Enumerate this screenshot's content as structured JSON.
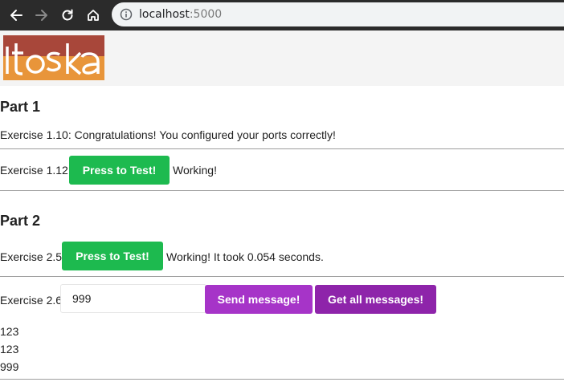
{
  "browser": {
    "url_host": "localhost",
    "url_port": ":5000"
  },
  "header": {
    "logo_text": "itoska"
  },
  "part1": {
    "heading": "Part 1",
    "ex110_text": "Exercise 1.10: Congratulations! You configured your ports correctly!",
    "ex112_label": "Exercise 1.12:",
    "ex112_button": "Press to Test!",
    "ex112_result": "Working!"
  },
  "part2": {
    "heading": "Part 2",
    "ex25_label": "Exercise 2.5:",
    "ex25_button": "Press to Test!",
    "ex25_result": "Working! It took 0.054 seconds.",
    "ex26_label": "Exercise 2.6:",
    "ex26_input_value": "999",
    "send_button": "Send message!",
    "get_button": "Get all messages!",
    "messages": [
      "123",
      "123",
      "999"
    ]
  },
  "colors": {
    "green": "#1dba4f",
    "purple_send": "#a634c8",
    "purple_get": "#8e24aa",
    "logo_orange": "#e8953a",
    "logo_red": "#a8473a"
  },
  "icons": [
    "back-icon",
    "forward-icon",
    "reload-icon",
    "home-icon",
    "info-icon"
  ]
}
